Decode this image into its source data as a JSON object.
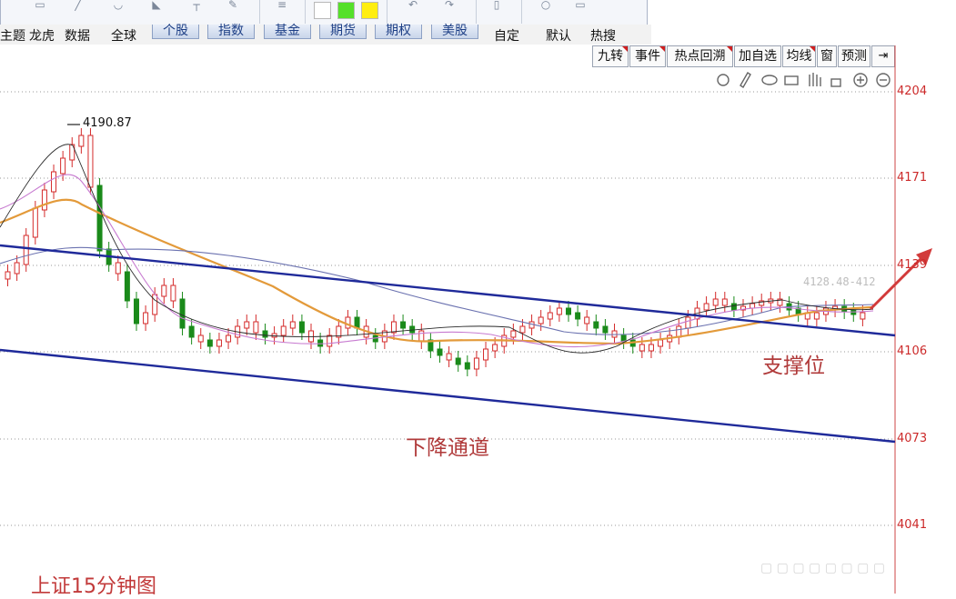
{
  "menu": {
    "items_left": [
      "主题",
      "龙虎",
      "数据",
      "全球"
    ],
    "tabs": [
      "个股",
      "指数",
      "基金",
      "期货",
      "期权",
      "美股"
    ],
    "items_right": [
      "自定",
      "默认",
      "热搜"
    ]
  },
  "right_tools": [
    {
      "label": "九转",
      "flag": true
    },
    {
      "label": "事件",
      "flag": true
    },
    {
      "label": "热点回溯",
      "flag": true
    },
    {
      "label": "加自选",
      "flag": false
    },
    {
      "label": "均线",
      "flag": true
    },
    {
      "label": "窗",
      "flag": false
    },
    {
      "label": "预测",
      "flag": false
    }
  ],
  "price_axis": {
    "ticks": [
      "4204",
      "4171",
      "4139",
      "4106",
      "4073",
      "4041"
    ]
  },
  "chart_data": {
    "type": "candlestick",
    "peak_label": "4190.87",
    "price_readout": "4128.48-412",
    "annotation_channel": "下降通道",
    "annotation_support": "支撑位",
    "caption": "上证15分钟图",
    "y_range": [
      4030,
      4215
    ],
    "colors": {
      "up": "#d42a2a",
      "down": "#1a8a1a",
      "channel": "#1f2a9a",
      "arrow": "#d23a3a"
    }
  },
  "icons": [
    "settings-icon",
    "pen-icon",
    "eye-icon",
    "cart-icon",
    "hand-icon",
    "lock-icon",
    "zoom-in-icon",
    "zoom-out-icon"
  ]
}
